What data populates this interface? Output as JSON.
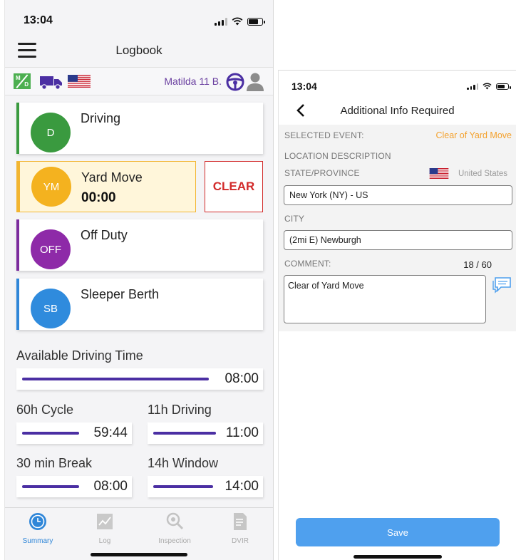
{
  "left_phone": {
    "status_bar": {
      "time": "13:04"
    },
    "header": {
      "title": "Logbook"
    },
    "info_bar": {
      "md_badge": {
        "top": "M",
        "bottom": "D"
      },
      "driver_name": "Matilda 11 B."
    },
    "statuses": [
      {
        "code": "D",
        "label": "Driving",
        "color": "#3a9a3f"
      },
      {
        "code": "YM",
        "label": "Yard Move",
        "timer": "00:00",
        "color": "#f4b21f",
        "active": true
      },
      {
        "code": "OFF",
        "label": "Off Duty",
        "color": "#8e2aa8"
      },
      {
        "code": "SB",
        "label": "Sleeper Berth",
        "color": "#2f8bdd"
      }
    ],
    "clear_button": "CLEAR",
    "available": {
      "title": "Available Driving Time",
      "value": "08:00",
      "fill": 1.0
    },
    "timers": [
      {
        "title": "60h Cycle",
        "value": "59:44",
        "fill": 1.0
      },
      {
        "title": "11h Driving",
        "value": "11:00",
        "fill": 1.0
      },
      {
        "title": "30 min Break",
        "value": "08:00",
        "fill": 1.0
      },
      {
        "title": "14h Window",
        "value": "14:00",
        "fill": 1.0
      }
    ],
    "tabs": [
      {
        "label": "Summary",
        "icon": "clock-icon",
        "active": true
      },
      {
        "label": "Log",
        "icon": "chart-icon"
      },
      {
        "label": "Inspection",
        "icon": "magnifier-icon"
      },
      {
        "label": "DVIR",
        "icon": "document-icon"
      }
    ]
  },
  "right_phone": {
    "status_bar": {
      "time": "13:04"
    },
    "header": {
      "title": "Additional Info Required"
    },
    "selected_event_label": "SELECTED EVENT:",
    "selected_event_value": "Clear of Yard Move",
    "location_description_label": "LOCATION DESCRIPTION",
    "state_label": "STATE/PROVINCE",
    "country": "United States",
    "state_value": "New York (NY) - US",
    "city_label": "CITY",
    "city_value": "(2mi E) Newburgh",
    "comment_label": "COMMENT:",
    "comment_counter": "18 / 60",
    "comment_value": "Clear of Yard Move",
    "save_button": "Save"
  },
  "colors": {
    "timer_bar": "#4b2fa3",
    "clear_red": "#d22a2a",
    "orange": "#f3a12d",
    "save_blue": "#4fa0ee",
    "active_tab": "#2f86d8"
  }
}
